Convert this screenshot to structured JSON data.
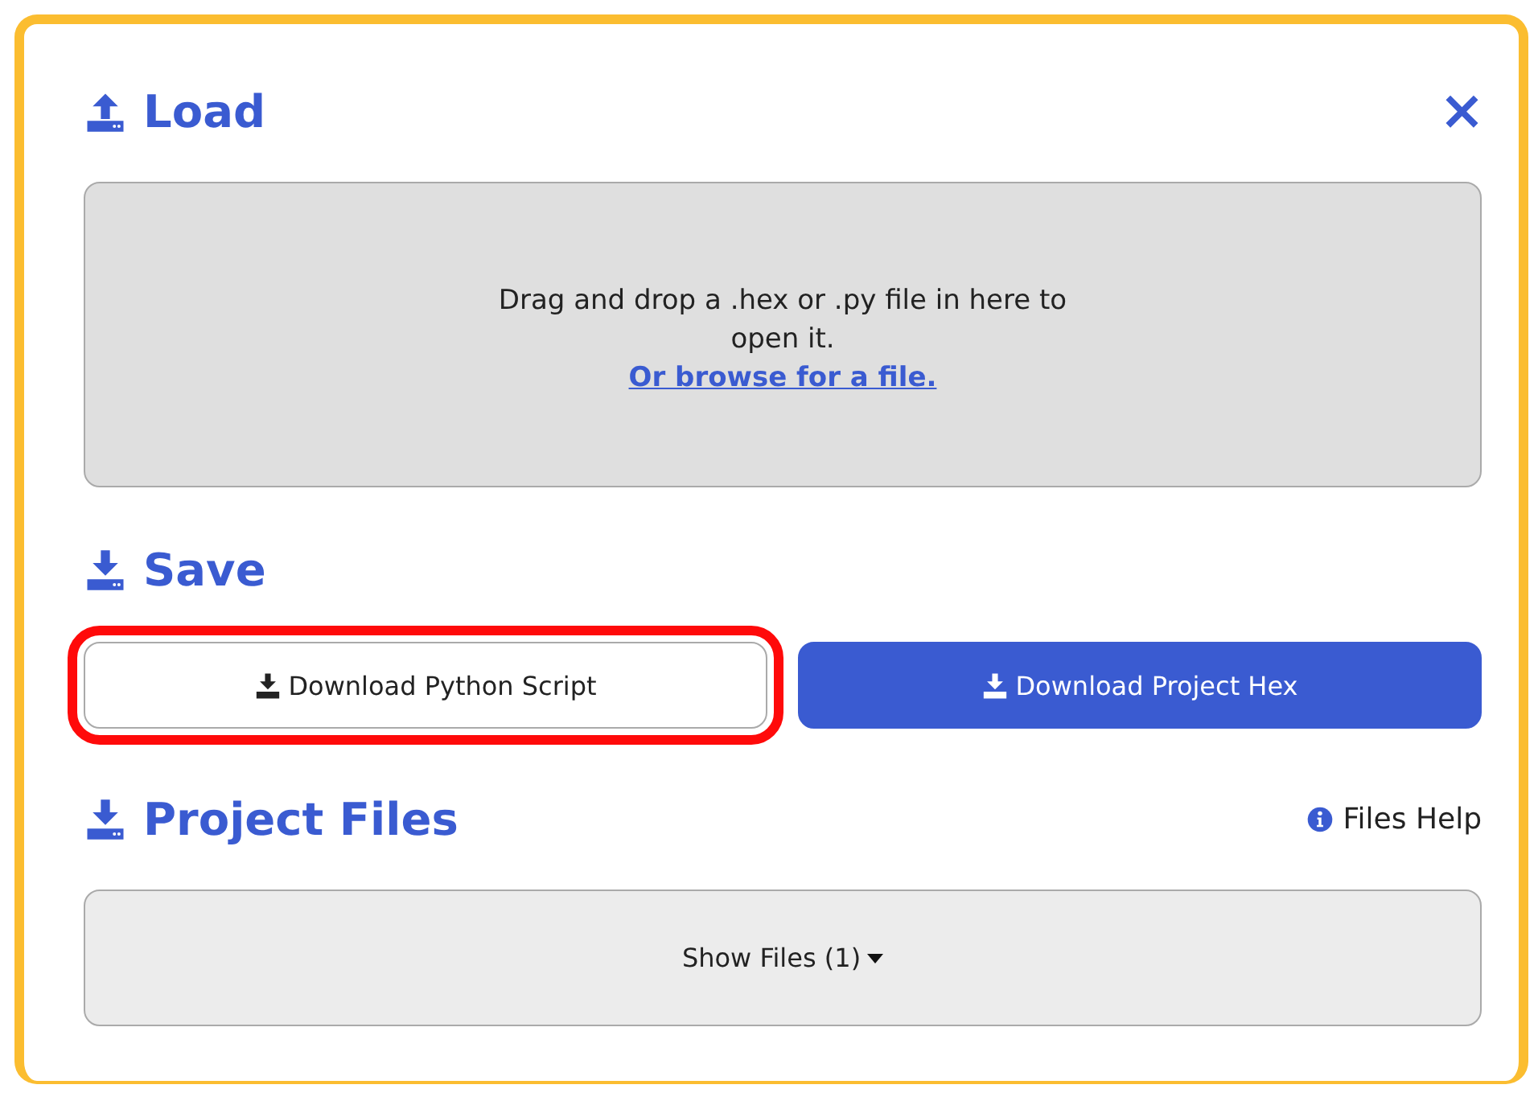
{
  "load": {
    "title": "Load",
    "drop_text": "Drag and drop a .hex or .py file in here to open it.",
    "browse_link": "Or browse for a file."
  },
  "close": {
    "label": "×"
  },
  "save": {
    "title": "Save",
    "buttons": [
      {
        "label": "Download Python Script",
        "kind": "outline",
        "highlighted": true
      },
      {
        "label": "Download Project Hex",
        "kind": "primary",
        "highlighted": false
      }
    ]
  },
  "project_files": {
    "title": "Project Files",
    "help": "Files Help",
    "toggle": "Show Files (1)",
    "expanded": false
  }
}
